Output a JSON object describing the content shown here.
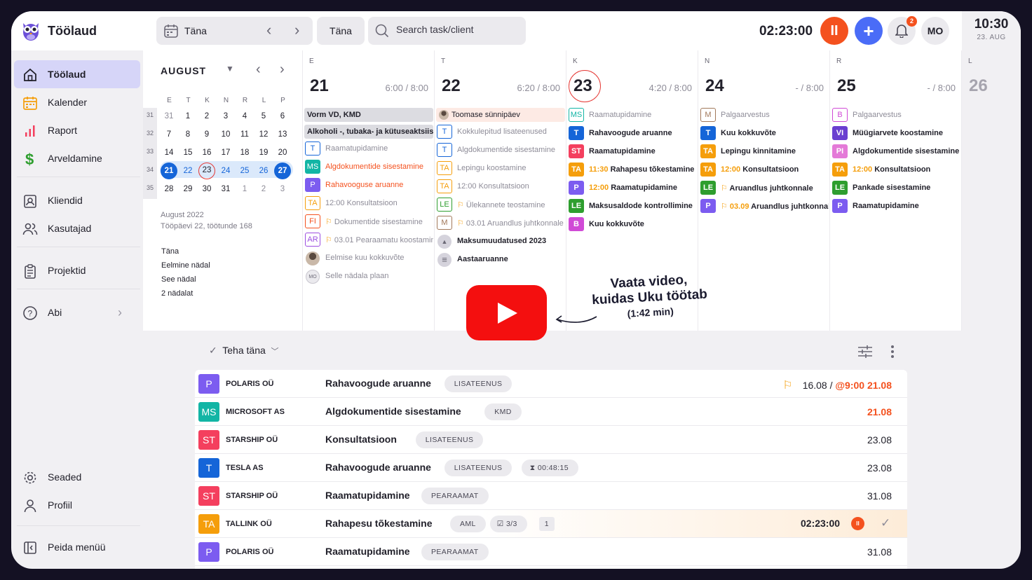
{
  "app": {
    "title": "Töölaud"
  },
  "topbar": {
    "date_label": "Täna",
    "today_button": "Täna",
    "search_placeholder": "Search task/client",
    "timer": "02:23:00",
    "notifications_count": "2",
    "avatar_initials": "MO",
    "add_symbol": "+",
    "pause_symbol": "II"
  },
  "clock": {
    "time": "10:30",
    "date": "23. AUG"
  },
  "sidebar": {
    "items": [
      {
        "label": "Töölaud",
        "icon": "home-icon",
        "active": true
      },
      {
        "label": "Kalender",
        "icon": "calendar-icon"
      },
      {
        "label": "Raport",
        "icon": "chart-icon"
      },
      {
        "label": "Arveldamine",
        "icon": "dollar-icon"
      },
      {
        "label": "Kliendid",
        "icon": "contacts-icon"
      },
      {
        "label": "Kasutajad",
        "icon": "users-icon"
      },
      {
        "label": "Projektid",
        "icon": "clipboard-icon"
      },
      {
        "label": "Abi",
        "icon": "help-icon"
      },
      {
        "label": "Seaded",
        "icon": "gear-icon"
      },
      {
        "label": "Profiil",
        "icon": "user-icon"
      },
      {
        "label": "Peida menüü",
        "icon": "collapse-icon"
      }
    ]
  },
  "mini_calendar": {
    "month": "AUGUST",
    "day_headers": [
      "E",
      "T",
      "K",
      "N",
      "R",
      "L",
      "P"
    ],
    "week_numbers": [
      "31",
      "32",
      "33",
      "34",
      "35"
    ],
    "weeks": [
      [
        "31",
        "1",
        "2",
        "3",
        "4",
        "5",
        "6"
      ],
      [
        "7",
        "8",
        "9",
        "10",
        "11",
        "12",
        "13"
      ],
      [
        "14",
        "15",
        "16",
        "17",
        "18",
        "19",
        "20"
      ],
      [
        "21",
        "22",
        "23",
        "24",
        "25",
        "26",
        "27"
      ],
      [
        "28",
        "29",
        "30",
        "31",
        "1",
        "2",
        "3"
      ]
    ],
    "footer_month": "August 2022",
    "footer_stats": "Tööpäevi 22, töötunde 168",
    "quick_links": [
      "Täna",
      "Eelmine nädal",
      "See nädal",
      "2 nädalat"
    ]
  },
  "days": [
    {
      "letter": "E",
      "num": "21",
      "hours": "6:00 / 8:00",
      "tasks": [
        {
          "style": "grey",
          "title": "Vorm VD, KMD"
        },
        {
          "style": "grey",
          "title": "Alkoholi -, tubaka- ja kütuseaktsiis"
        },
        {
          "tag": "T",
          "tagcolor": "#1565d8",
          "outline": true,
          "title": "Raamatupidamine",
          "tone": "muted"
        },
        {
          "tag": "MS",
          "tagcolor": "#12b5a5",
          "title": "Algdokumentide sisestamine",
          "tone": "orange"
        },
        {
          "tag": "P",
          "tagcolor": "#7c5cf0",
          "title": "Rahavooguse aruanne",
          "tone": "orange"
        },
        {
          "tag": "TA",
          "tagcolor": "#f59e0b",
          "outline": true,
          "title": "12:00 Konsultatsioon",
          "tone": "muted"
        },
        {
          "tag": "FI",
          "tagcolor": "#f4511e",
          "outline": true,
          "flag": true,
          "title": "Dokumentide sisestamine",
          "tone": "muted"
        },
        {
          "tag": "AR",
          "tagcolor": "#9c4de0",
          "outline": true,
          "flag": true,
          "title": "03.01 Pearaamatu koostamine",
          "tone": "muted"
        },
        {
          "avatar": "photo",
          "title": "Eelmise kuu kokkuvõte",
          "tone": "muted"
        },
        {
          "avatar": "MO",
          "title": "Selle nädala plaan",
          "tone": "muted"
        }
      ]
    },
    {
      "letter": "T",
      "num": "22",
      "hours": "6:20 / 8:00",
      "tasks": [
        {
          "style": "peach",
          "avatar": "photo",
          "title": "Toomase sünnipäev"
        },
        {
          "tag": "T",
          "tagcolor": "#1565d8",
          "outline": true,
          "title": "Kokkulepitud lisateenused",
          "tone": "muted"
        },
        {
          "tag": "T",
          "tagcolor": "#1565d8",
          "outline": true,
          "title": "Algdokumentide sisestamine",
          "tone": "muted"
        },
        {
          "tag": "TA",
          "tagcolor": "#f59e0b",
          "outline": true,
          "title": "Lepingu koostamine",
          "tone": "muted"
        },
        {
          "tag": "TA",
          "tagcolor": "#f59e0b",
          "outline": true,
          "title": "12:00 Konsultatsioon",
          "tone": "muted"
        },
        {
          "tag": "LE",
          "tagcolor": "#2e9e2e",
          "outline": true,
          "flag": true,
          "title": "Ülekannete teostamine",
          "tone": "muted"
        },
        {
          "tag": "M",
          "tagcolor": "#a1785a",
          "outline": true,
          "flag": true,
          "title": "03.01 Aruandlus juhtkonnale",
          "tone": "muted"
        },
        {
          "avatar": "cap",
          "title": "Maksumuudatused 2023",
          "tone": "dark"
        },
        {
          "avatar": "list",
          "title": "Aastaaruanne",
          "tone": "dark"
        }
      ]
    },
    {
      "letter": "K",
      "num": "23",
      "hours": "4:20 / 8:00",
      "today": true,
      "tasks": [
        {
          "tag": "MS",
          "tagcolor": "#12b5a5",
          "outline": true,
          "title": "Raamatupidamine",
          "tone": "muted"
        },
        {
          "tag": "T",
          "tagcolor": "#1565d8",
          "title": "Rahavoogude aruanne",
          "tone": "dark"
        },
        {
          "tag": "ST",
          "tagcolor": "#f43f5e",
          "title": "Raamatupidamine",
          "tone": "dark"
        },
        {
          "tag": "TA",
          "tagcolor": "#f59e0b",
          "time": "11:30",
          "title": "Rahapesu tõkestamine",
          "tone": "dark"
        },
        {
          "tag": "P",
          "tagcolor": "#7c5cf0",
          "time": "12:00",
          "title": "Raamatupidamine",
          "tone": "dark"
        },
        {
          "tag": "LE",
          "tagcolor": "#2e9e2e",
          "title": "Maksusaldode kontrollimine",
          "tone": "dark"
        },
        {
          "tag": "B",
          "tagcolor": "#d04ad6",
          "title": "Kuu kokkuvõte",
          "tone": "dark"
        }
      ]
    },
    {
      "letter": "N",
      "num": "24",
      "hours": "- / 8:00",
      "tasks": [
        {
          "tag": "M",
          "tagcolor": "#a1785a",
          "outline": true,
          "title": "Palgaarvestus",
          "tone": "muted"
        },
        {
          "tag": "T",
          "tagcolor": "#1565d8",
          "title": "Kuu kokkuvõte",
          "tone": "dark"
        },
        {
          "tag": "TA",
          "tagcolor": "#f59e0b",
          "title": "Lepingu kinnitamine",
          "tone": "dark"
        },
        {
          "tag": "TA",
          "tagcolor": "#f59e0b",
          "time": "12:00",
          "title": "Konsultatsioon",
          "tone": "dark"
        },
        {
          "tag": "LE",
          "tagcolor": "#2e9e2e",
          "flag": true,
          "title": "Aruandlus juhtkonnale",
          "tone": "dark"
        },
        {
          "tag": "P",
          "tagcolor": "#7c5cf0",
          "flag": true,
          "time": "03.09",
          "title": "Aruandlus juhtkonnale",
          "tone": "dark"
        }
      ]
    },
    {
      "letter": "R",
      "num": "25",
      "hours": "- / 8:00",
      "tasks": [
        {
          "tag": "B",
          "tagcolor": "#d04ad6",
          "outline": true,
          "title": "Palgaarvestus",
          "tone": "muted"
        },
        {
          "tag": "VI",
          "tagcolor": "#6a3fd0",
          "title": "Müügiarvete koostamine",
          "tone": "dark"
        },
        {
          "tag": "PI",
          "tagcolor": "#e47ad8",
          "title": "Algdokumentide sisestamine",
          "tone": "dark"
        },
        {
          "tag": "TA",
          "tagcolor": "#f59e0b",
          "time": "12:00",
          "title": "Konsultatsioon",
          "tone": "dark"
        },
        {
          "tag": "LE",
          "tagcolor": "#2e9e2e",
          "title": "Pankade sisestamine",
          "tone": "dark"
        },
        {
          "tag": "P",
          "tagcolor": "#7c5cf0",
          "title": "Raamatupidamine",
          "tone": "dark"
        }
      ]
    },
    {
      "letter": "L",
      "num": "26",
      "hours": "",
      "weekend": true,
      "tasks": []
    }
  ],
  "video": {
    "line1": "Vaata video,",
    "line2": "kuidas Uku töötab",
    "line3": "(1:42 min)"
  },
  "list": {
    "filter_label": "Teha täna",
    "rows": [
      {
        "tag": "P",
        "tagcolor": "#7c5cf0",
        "client": "POLARIS OÜ",
        "title": "Rahavoogude aruanne",
        "pills": [
          "LISATEENUS"
        ],
        "flag": true,
        "date_prefix": "16.08 / ",
        "date": "@9:00 21.08",
        "date_red": true
      },
      {
        "tag": "MS",
        "tagcolor": "#12b5a5",
        "client": "MICROSOFT AS",
        "title": "Algdokumentide sisestamine",
        "pills": [
          "KMD"
        ],
        "date": "21.08",
        "date_red": true
      },
      {
        "tag": "ST",
        "tagcolor": "#f43f5e",
        "client": "STARSHIP OÜ",
        "title": "Konsultatsioon",
        "pills": [
          "LISATEENUS"
        ],
        "date": "23.08"
      },
      {
        "tag": "T",
        "tagcolor": "#1565d8",
        "client": "TESLA AS",
        "title": "Rahavoogude aruanne",
        "pills": [
          "LISATEENUS"
        ],
        "timer_pill": "00:48:15",
        "date": "23.08"
      },
      {
        "tag": "ST",
        "tagcolor": "#f43f5e",
        "client": "STARSHIP OÜ",
        "title": "Raamatupidamine",
        "pills": [
          "PEARAAMAT"
        ],
        "date": "31.08"
      },
      {
        "tag": "TA",
        "tagcolor": "#f59e0b",
        "client": "TALLINK OÜ",
        "title": "Rahapesu tõkestamine",
        "pills": [
          "AML"
        ],
        "check_pill": "3/3",
        "count_pill": "1",
        "running": "02:23:00",
        "highlight": true
      },
      {
        "tag": "P",
        "tagcolor": "#7c5cf0",
        "client": "POLARIS OÜ",
        "title": "Raamatupidamine",
        "pills": [
          "PEARAAMAT"
        ],
        "date": "31.08"
      }
    ]
  }
}
